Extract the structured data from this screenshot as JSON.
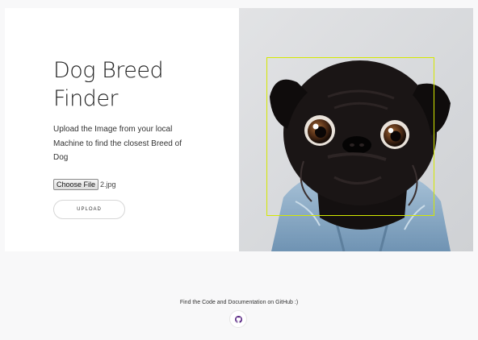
{
  "hero": {
    "title": "Dog Breed Finder",
    "description": "Upload the Image from your local Machine to find the closest Breed of Dog",
    "file_input": {
      "button_label": "Choose File",
      "file_name": "2.jpg"
    },
    "upload_label": "UPLOAD"
  },
  "photo": {
    "subject": "pug-photo",
    "detection_box_color": "#d4e800"
  },
  "footer": {
    "text": "Find the Code and Documentation on GitHub :)",
    "github_icon": "github-icon",
    "icon_color": "#5b2a86"
  }
}
